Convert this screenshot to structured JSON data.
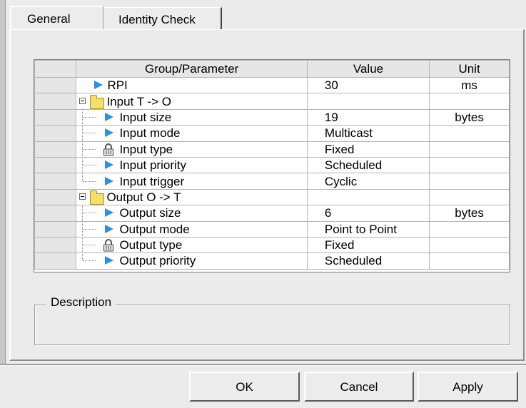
{
  "tabs": [
    {
      "label": "General",
      "active": true
    },
    {
      "label": "Identity Check",
      "active": false
    }
  ],
  "grid": {
    "headers": {
      "group": "Group/Parameter",
      "value": "Value",
      "unit": "Unit"
    },
    "rows": [
      {
        "name": "RPI",
        "value": "30",
        "unit": "ms",
        "icon": "arrow-icon",
        "level": 0
      },
      {
        "name": "Input T -> O",
        "value": "",
        "unit": "",
        "icon": "folder-icon",
        "level": 0,
        "group": true
      },
      {
        "name": "Input size",
        "value": "19",
        "unit": "bytes",
        "icon": "arrow-icon",
        "level": 1
      },
      {
        "name": "Input mode",
        "value": "Multicast",
        "unit": "",
        "icon": "arrow-icon",
        "level": 1
      },
      {
        "name": "Input type",
        "value": "Fixed",
        "unit": "",
        "icon": "lock-icon",
        "level": 1
      },
      {
        "name": "Input priority",
        "value": "Scheduled",
        "unit": "",
        "icon": "arrow-icon",
        "level": 1
      },
      {
        "name": "Input trigger",
        "value": "Cyclic",
        "unit": "",
        "icon": "arrow-icon",
        "level": 1,
        "last": true
      },
      {
        "name": "Output O -> T",
        "value": "",
        "unit": "",
        "icon": "folder-icon",
        "level": 0,
        "group": true
      },
      {
        "name": "Output size",
        "value": "6",
        "unit": "bytes",
        "icon": "arrow-icon",
        "level": 1
      },
      {
        "name": "Output mode",
        "value": "Point to Point",
        "unit": "",
        "icon": "arrow-icon",
        "level": 1
      },
      {
        "name": "Output type",
        "value": "Fixed",
        "unit": "",
        "icon": "lock-icon",
        "level": 1
      },
      {
        "name": "Output priority",
        "value": "Scheduled",
        "unit": "",
        "icon": "arrow-icon",
        "level": 1,
        "last": true
      }
    ]
  },
  "description": {
    "label": "Description",
    "text": ""
  },
  "buttons": {
    "ok": "OK",
    "cancel": "Cancel",
    "apply": "Apply"
  },
  "colors": {
    "arrow": "#2d8fe0",
    "folder": "#f7dd6b",
    "background": "#ebebeb"
  }
}
